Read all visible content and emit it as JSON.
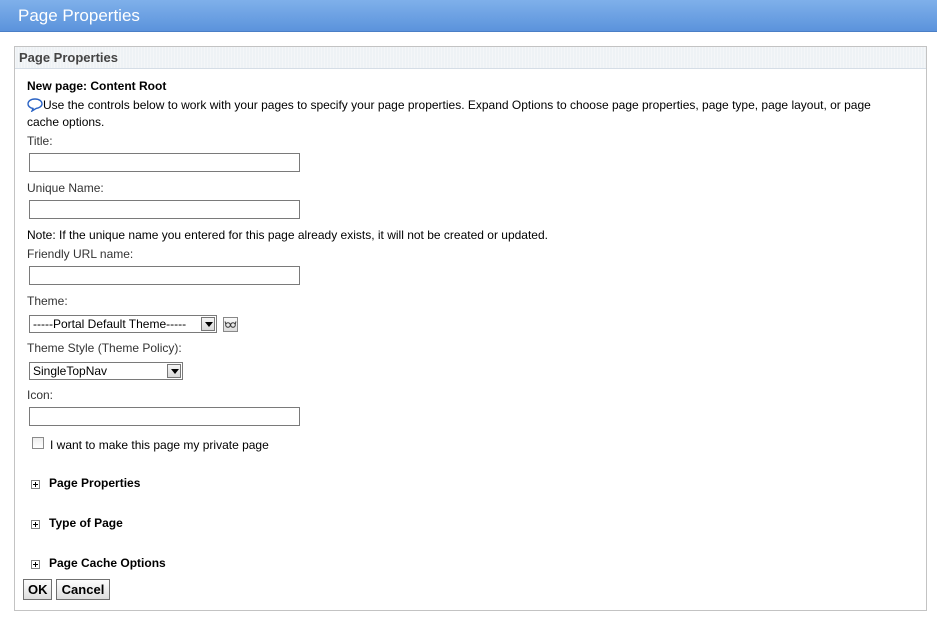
{
  "window": {
    "title": "Page Properties"
  },
  "panel": {
    "title": "Page Properties",
    "new_page_label": "New page: Content Root",
    "help_line1": "Use the controls below to work with your pages to specify your page properties. Expand Options to choose page properties, page type, page layout, or page",
    "help_line2": "cache options."
  },
  "form": {
    "title_label": "Title:",
    "title_value": "",
    "unique_name_label": "Unique Name:",
    "unique_name_value": "",
    "unique_note": "Note: If the unique name you entered for this page already exists, it will not be created or updated.",
    "friendly_url_label": "Friendly URL name:",
    "friendly_url_value": "",
    "theme_label": "Theme:",
    "theme_value": "-----Portal Default Theme-----",
    "theme_style_label": "Theme Style (Theme Policy):",
    "theme_style_value": "SingleTopNav",
    "icon_label": "Icon:",
    "icon_value": "",
    "private_label": "I want to make this page my private page",
    "private_checked": false
  },
  "sections": [
    {
      "label": "Page Properties",
      "expanded": false
    },
    {
      "label": "Type of Page",
      "expanded": false
    },
    {
      "label": "Page Cache Options",
      "expanded": false
    }
  ],
  "buttons": {
    "ok": "OK",
    "cancel": "Cancel"
  }
}
